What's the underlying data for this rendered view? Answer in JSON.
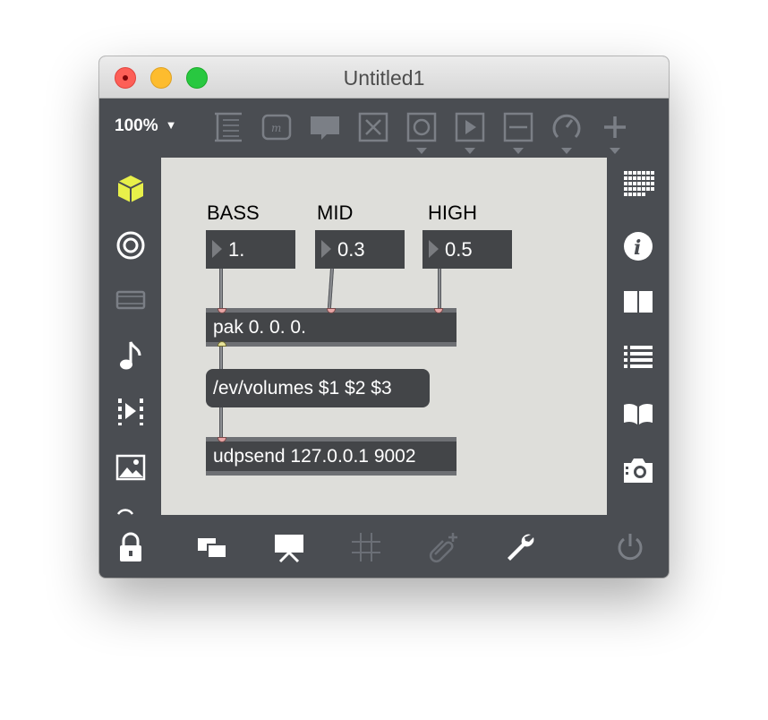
{
  "window": {
    "title": "Untitled1",
    "traffic_lights": [
      "close",
      "minimize",
      "zoom"
    ]
  },
  "toolbar": {
    "zoom_level": "100%",
    "zoom_caret": "▼",
    "icons": [
      "comment-presentation-icon",
      "message-icon",
      "comment-icon",
      "toggle-icon",
      "button-icon",
      "play-icon",
      "slider-icon",
      "dial-icon",
      "add-object-icon"
    ]
  },
  "left_sidebar": {
    "icons": [
      "package-cube-icon",
      "target-icon",
      "device-icon",
      "music-note-icon",
      "media-step-icon",
      "image-icon",
      "more-icon"
    ]
  },
  "right_sidebar": {
    "icons": [
      "grid-palette-icon",
      "info-icon",
      "book-icon",
      "list-icon",
      "reference-book-icon",
      "snapshot-camera-icon"
    ]
  },
  "patch": {
    "labels": {
      "bass": "BASS",
      "mid": "MID",
      "high": "HIGH"
    },
    "number_boxes": {
      "bass": "1.",
      "mid": "0.3",
      "high": "0.5"
    },
    "pak_object": "pak 0. 0. 0.",
    "message_box": "/ev/volumes $1 $2 $3",
    "udpsend_object": "udpsend 127.0.0.1 9002"
  },
  "bottom_toolbar": {
    "icons": [
      "lock-icon",
      "windows-icon",
      "presentation-icon",
      "grid-icon",
      "attach-icon",
      "wrench-icon",
      "power-icon"
    ]
  },
  "colors": {
    "chrome": "#4a4d52",
    "canvas": "#dededa",
    "object_fill": "#434548",
    "accent_cube": "#e8f04a",
    "inlet": "#e8a6a6",
    "outlet": "#e6e29a"
  }
}
